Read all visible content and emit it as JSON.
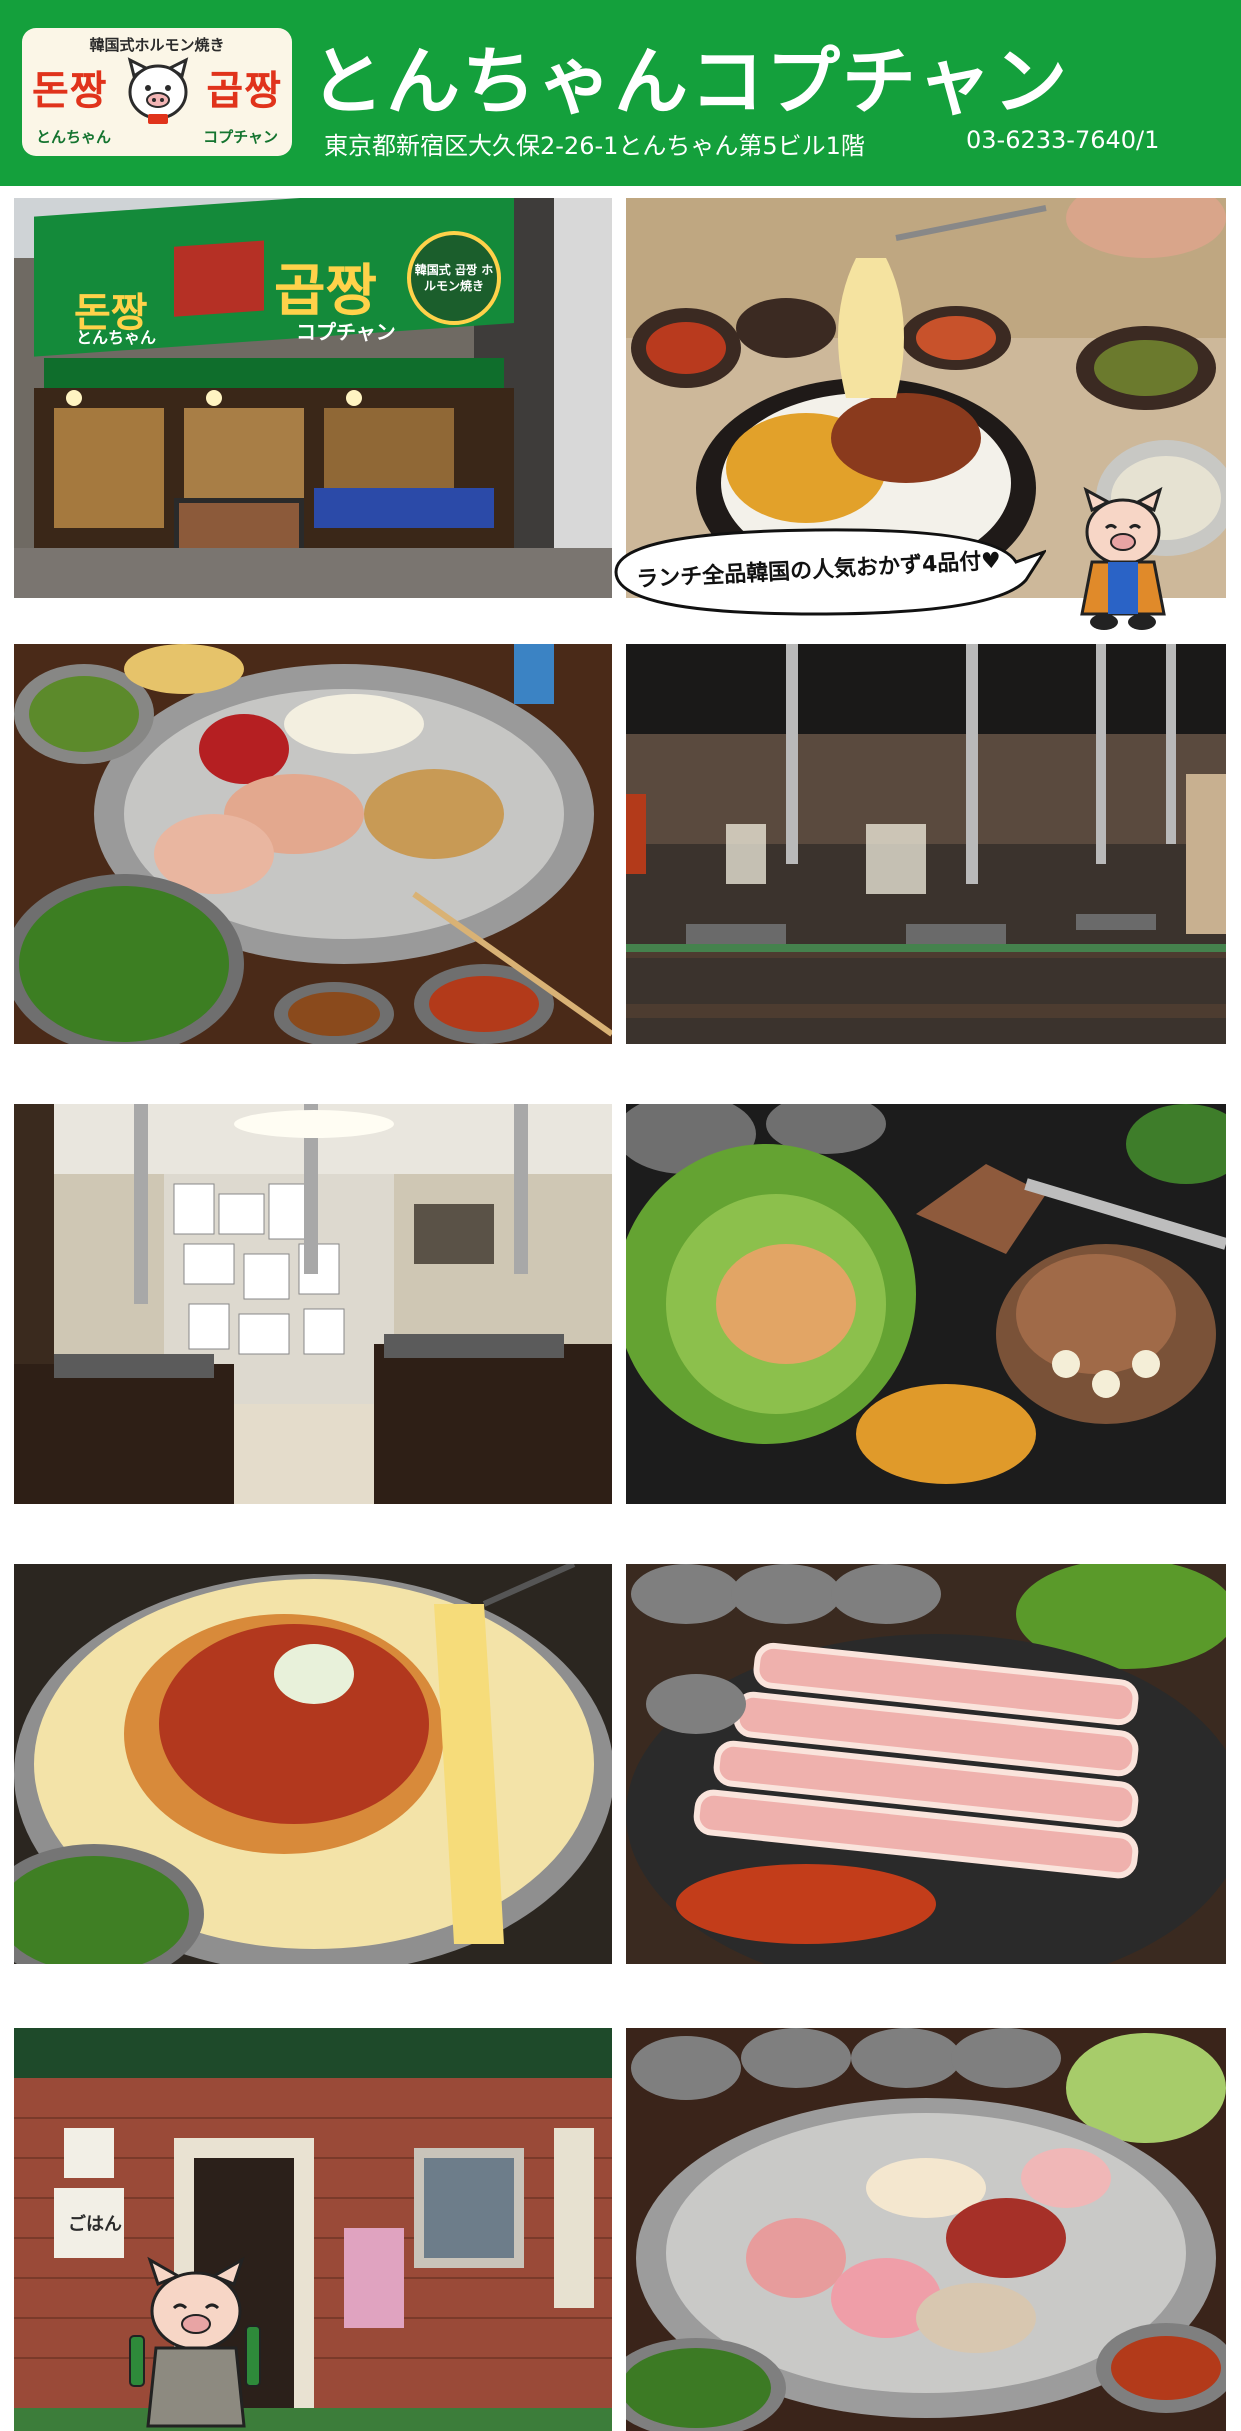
{
  "header": {
    "logo": {
      "tagline": "韓国式ホルモン焼き",
      "korean_left": "돈짱",
      "korean_right": "곱짱",
      "kana_left": "とんちゃん",
      "kana_right": "コプチャン",
      "badge": "돈짱"
    },
    "title": "とんちゃんコプチャン",
    "address": "東京都新宿区大久保2-26-1とんちゃん第5ビル1階",
    "phone": "03-6233-7640/1"
  },
  "photos": {
    "storefront": {
      "sign_main": "곱짱",
      "sign_sub": "コプチャン",
      "sign_left": "돈짱",
      "sign_left_sub": "とんちゃん",
      "sign_badge": "韓国式 곱짱 ホルモン焼き"
    },
    "lunch": {
      "bubble_text": "ランチ全品韓国の人気おかず4品付♥"
    },
    "alley": {
      "menu_label": "ごはん"
    }
  },
  "colors": {
    "brand_green": "#14a03c",
    "logo_red": "#e0331b",
    "white": "#ffffff"
  }
}
